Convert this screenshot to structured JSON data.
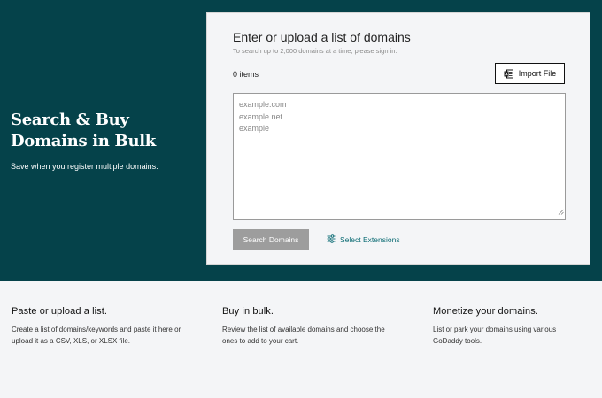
{
  "hero": {
    "title": "Search & Buy Domains in Bulk",
    "subtitle": "Save when you register multiple domains."
  },
  "panel": {
    "title": "Enter or upload a list of domains",
    "subtitle": "To search up to 2,000 domains at a time, please sign in.",
    "item_count": "0 items",
    "import_button": {
      "label": "Import File",
      "icon": "excel-file-icon"
    },
    "domain_input": {
      "placeholder_lines": [
        "example.com",
        "example.net",
        "example"
      ],
      "value": ""
    },
    "search_button": "Search Domains",
    "extensions_link": {
      "label": "Select Extensions",
      "icon": "sliders-icon"
    }
  },
  "features": [
    {
      "title": "Paste or upload a list.",
      "description": "Create a list of domains/keywords and paste it here or upload it as a CSV, XLS, or XLSX file."
    },
    {
      "title": "Buy in bulk.",
      "description": "Review the list of available domains and choose the ones to add to your cart."
    },
    {
      "title": "Monetize your domains.",
      "description": "List or park your domains using various GoDaddy tools."
    }
  ],
  "colors": {
    "hero_background": "#05424a",
    "link_teal": "#0a6b73",
    "disabled_button": "#9d9d9d",
    "page_background": "#f4f5f7"
  }
}
